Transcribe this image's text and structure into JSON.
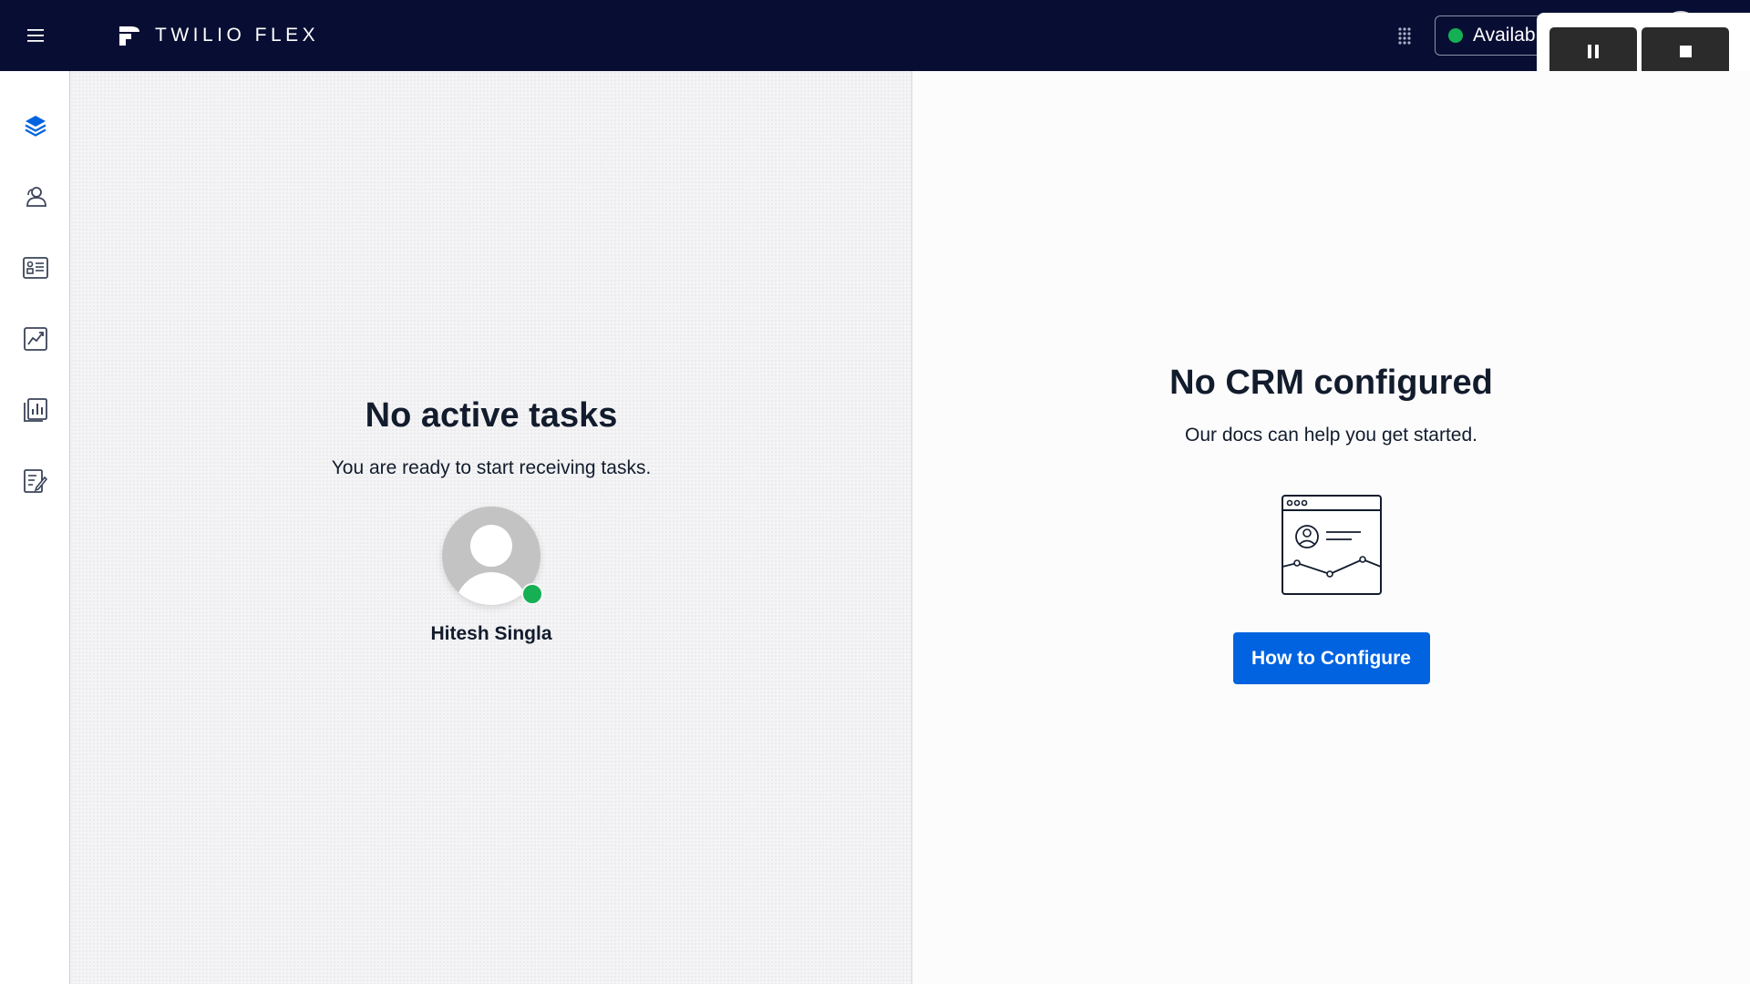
{
  "header": {
    "brand": "TWILIO FLEX",
    "status_label": "Availab",
    "status_color": "#14b053",
    "background": "#080e33"
  },
  "icons": {
    "menu": "hamburger-menu-icon",
    "logo": "twilio-flex-logo-icon",
    "apps": "grid-apps-icon"
  },
  "sidebar": {
    "items": [
      {
        "name": "layers-icon",
        "active": true
      },
      {
        "name": "agents-icon",
        "active": false
      },
      {
        "name": "contact-card-icon",
        "active": false
      },
      {
        "name": "analytics-chart-icon",
        "active": false
      },
      {
        "name": "reports-bar-chart-icon",
        "active": false
      },
      {
        "name": "edit-notes-icon",
        "active": false
      }
    ]
  },
  "tasks": {
    "title": "No active tasks",
    "subtitle": "You are ready to start receiving tasks.",
    "agent_name": "Hitesh Singla"
  },
  "crm": {
    "title": "No CRM configured",
    "subtitle": "Our docs can help you get started.",
    "button_label": "How to Configure",
    "button_color": "#0263e0"
  },
  "recorder": {
    "pause": "pause-icon",
    "stop": "stop-icon"
  }
}
